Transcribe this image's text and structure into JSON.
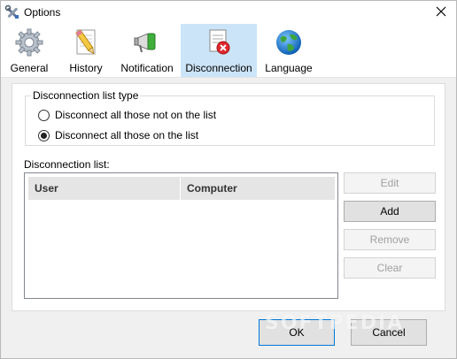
{
  "window": {
    "title": "Options",
    "app_icon": "tools-icon",
    "close_icon": "close-icon"
  },
  "tabs": [
    {
      "label": "General",
      "icon": "gear-icon",
      "active": false
    },
    {
      "label": "History",
      "icon": "pencil-paper-icon",
      "active": false
    },
    {
      "label": "Notification",
      "icon": "megaphone-icon",
      "active": false
    },
    {
      "label": "Disconnection",
      "icon": "document-error-icon",
      "active": true
    },
    {
      "label": "Language",
      "icon": "globe-icon",
      "active": false
    }
  ],
  "disconnection": {
    "group_title": "Disconnection list type",
    "options": [
      {
        "label": "Disconnect all those not on the list",
        "selected": false
      },
      {
        "label": "Disconnect all those on the list",
        "selected": true
      }
    ],
    "list_label": "Disconnection list:",
    "columns": [
      "User",
      "Computer"
    ],
    "rows": [],
    "buttons": [
      {
        "label": "Edit",
        "enabled": false
      },
      {
        "label": "Add",
        "enabled": true
      },
      {
        "label": "Remove",
        "enabled": false
      },
      {
        "label": "Clear",
        "enabled": false
      }
    ]
  },
  "footer": {
    "ok_label": "OK",
    "cancel_label": "Cancel"
  },
  "watermark": "SOFTPEDIA",
  "colors": {
    "active_tab": "#cce4f7",
    "default_button_border": "#0078d7",
    "error_red": "#e0262d"
  }
}
